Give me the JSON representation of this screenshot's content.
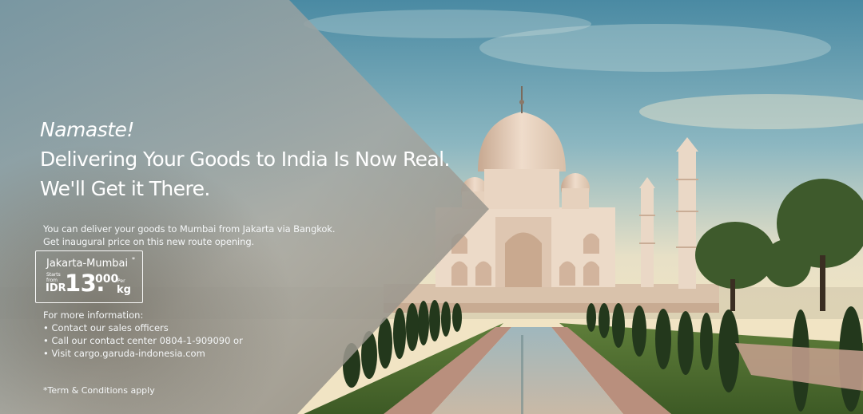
{
  "headline": {
    "greeting": "Namaste!",
    "line1": "Delivering Your Goods to India Is Now Real.",
    "line2": "We'll Get it There."
  },
  "intro": {
    "line1": "You can deliver your goods to Mumbai from Jakarta via Bangkok.",
    "line2": "Get inaugural price on this  new route opening."
  },
  "price_box": {
    "route": "Jakarta-Mumbai",
    "route_mark": "*",
    "starts_from": "Starts from",
    "currency": "IDR",
    "price_main": "13.",
    "price_decimal": "000",
    "per": "Per",
    "unit": "kg"
  },
  "info": {
    "heading": "For more information:",
    "items": [
      "• Contact our sales officers",
      "• Call our contact center 0804-1-909090 or",
      "• Visit cargo.garuda-indonesia.com"
    ]
  },
  "terms": "*Term & Conditions apply",
  "colors": {
    "sky_top": "#4f8fa6",
    "sky_bottom": "#e9e2c8",
    "marble": "#ead7c4",
    "foliage": "#2f4a24",
    "overlay_tint": "#b9c3c6"
  }
}
